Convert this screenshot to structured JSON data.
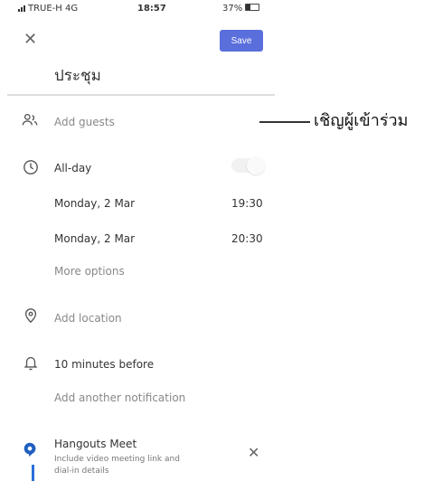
{
  "status": {
    "carrier": "TRUE-H 4G",
    "time": "18:57",
    "battery": "37%"
  },
  "header": {
    "close_icon": "close-icon",
    "save_label": "Save"
  },
  "event": {
    "title": "ประชุม"
  },
  "guests": {
    "icon": "people-icon",
    "label": "Add guests",
    "annotation": "เชิญผู้เข้าร่วม"
  },
  "schedule": {
    "icon": "clock-icon",
    "all_day_label": "All-day",
    "all_day_on": false,
    "start_date": "Monday, 2 Mar",
    "start_time": "19:30",
    "end_date": "Monday, 2 Mar",
    "end_time": "20:30",
    "more_options": "More options"
  },
  "location": {
    "icon": "location-pin-icon",
    "label": "Add location"
  },
  "notification": {
    "icon": "bell-icon",
    "label": "10 minutes before",
    "add_label": "Add another notification"
  },
  "meet": {
    "icon": "hangouts-meet-icon",
    "title": "Hangouts Meet",
    "subtitle_line1": "Include video meeting link and",
    "subtitle_line2": "dial-in details"
  },
  "colors": {
    "accent": "#5a6fdc",
    "meet": "#2a6fdb"
  }
}
